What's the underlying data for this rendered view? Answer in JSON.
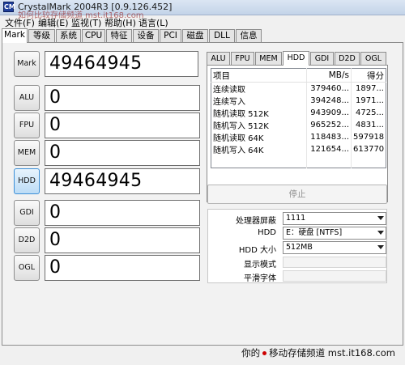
{
  "window": {
    "title": "CrystalMark 2004R3 [0.9.126.452]",
    "icon_label": "CM",
    "watermark_top": "如何比较存储频道 mst.it168.com"
  },
  "menu": [
    "文件(F)",
    "编辑(E)",
    "监视(T)",
    "帮助(H)",
    "语言(L)"
  ],
  "top_tabs": [
    "Mark",
    "等级",
    "系统",
    "CPU",
    "特征",
    "设备",
    "PCI",
    "磁盘",
    "DLL",
    "信息"
  ],
  "active_top_tab": "Mark",
  "scores": [
    {
      "label": "Mark",
      "value": "49464945"
    },
    {
      "label": "ALU",
      "value": "0"
    },
    {
      "label": "FPU",
      "value": "0"
    },
    {
      "label": "MEM",
      "value": "0"
    },
    {
      "label": "HDD",
      "value": "49464945"
    },
    {
      "label": "GDI",
      "value": "0"
    },
    {
      "label": "D2D",
      "value": "0"
    },
    {
      "label": "OGL",
      "value": "0"
    }
  ],
  "result_tabs": [
    "ALU",
    "FPU",
    "MEM",
    "HDD",
    "GDI",
    "D2D",
    "OGL"
  ],
  "active_result_tab": "HDD",
  "result_table": {
    "headers": [
      "项目",
      "MB/s",
      "得分"
    ],
    "rows": [
      [
        "连续读取",
        "379460...",
        "1897..."
      ],
      [
        "连续写入",
        "394248...",
        "1971..."
      ],
      [
        "随机读取 512K",
        "943909...",
        "4725..."
      ],
      [
        "随机写入 512K",
        "965252...",
        "4831..."
      ],
      [
        "随机读取 64K",
        "118483...",
        "597918"
      ],
      [
        "随机写入 64K",
        "121654...",
        "613770"
      ]
    ]
  },
  "stop_button": "停止",
  "settings": {
    "screen_label": "处理器屏蔽",
    "screen_value": "1111",
    "hdd_label": "HDD",
    "hdd_value": "E：硬盘 [NTFS]",
    "size_label": "HDD 大小",
    "size_value": "512MB",
    "display_mode_label": "显示模式",
    "smooth_font_label": "平滑字体"
  },
  "footer_watermark": {
    "left": "你的",
    "right": "移动存储频道  mst.it168.com"
  }
}
